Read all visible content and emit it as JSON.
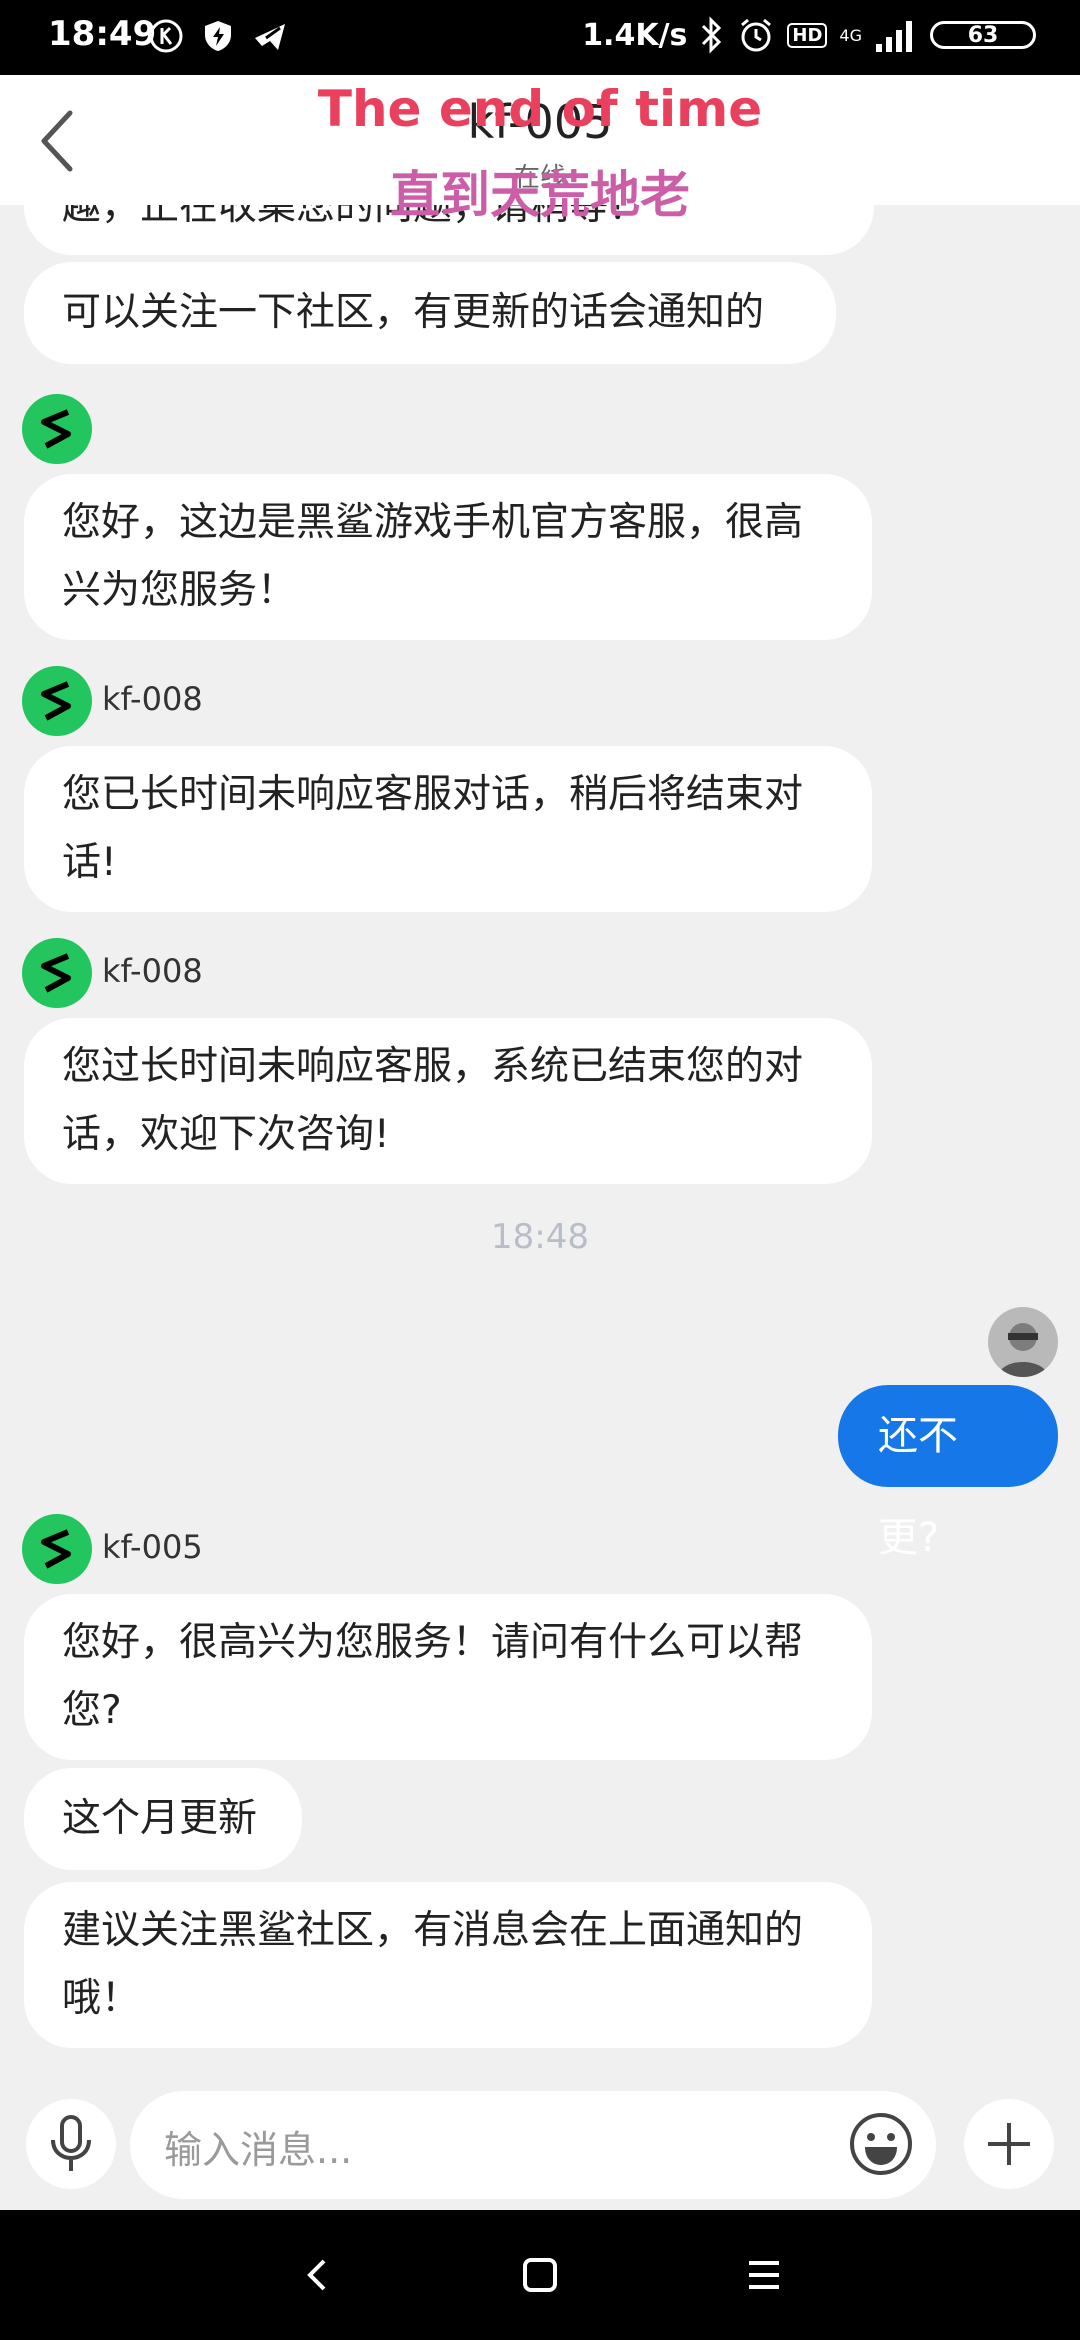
{
  "status_bar": {
    "time": "18:49",
    "speed": "1.4K/s",
    "hd": "HD",
    "network": "4G",
    "battery": "63"
  },
  "header": {
    "title": "kf-005",
    "subtitle": "在线",
    "overlay_en": "The end of time",
    "overlay_cn": "直到天荒地老"
  },
  "messages": {
    "partial_cut": "趣，正在收集您的问题，请稍等！",
    "msg1": "可以关注一下社区，有更新的话会通知的",
    "msg2": "您好，这边是黑鲨游戏手机官方客服，很高兴为您服务！",
    "agent3": "kf-008",
    "msg3": "您已长时间未响应客服对话，稍后将结束对话!",
    "agent4": "kf-008",
    "msg4": "您过长时间未响应客服，系统已结束您的对话，欢迎下次咨询!",
    "timestamp": "18:48",
    "user_msg": "还不更?",
    "agent5": "kf-005",
    "msg5": "您好，很高兴为您服务！请问有什么可以帮您?",
    "msg6": "这个月更新",
    "msg7": "建议关注黑鲨社区，有消息会在上面通知的哦！"
  },
  "input": {
    "placeholder": "输入消息..."
  },
  "colors": {
    "accent": "#1677e8",
    "agent_avatar": "#22c55e",
    "overlay_en": "#e8405d",
    "overlay_cn": "#cc5ea8"
  },
  "icons": [
    "back-arrow-icon",
    "microphone-icon",
    "emoji-icon",
    "plus-icon",
    "nav-back-icon",
    "nav-home-icon",
    "nav-menu-icon"
  ]
}
